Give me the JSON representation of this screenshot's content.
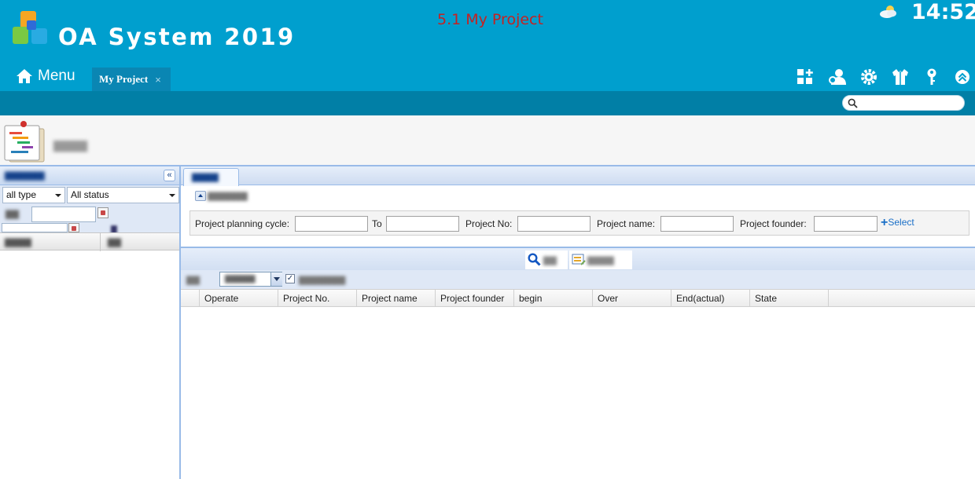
{
  "app": {
    "title": "OA System 2019",
    "page_heading": "5.1 My Project",
    "clock": "14:52",
    "weather_icon": "partly-cloudy-icon"
  },
  "nav": {
    "menu_label": "Menu",
    "tabs": [
      {
        "label": "My Project",
        "close": "×",
        "active": true
      }
    ],
    "header_icons": [
      "add-widget-icon",
      "user-settings-icon",
      "gear-icon",
      "shirt-icon",
      "key-icon",
      "collapse-up-icon"
    ],
    "search": {
      "placeholder": "",
      "value": ""
    }
  },
  "left_panel": {
    "type_select": "all type",
    "status_select": "All status"
  },
  "search_form": {
    "cycle_label": "Project planning cycle:",
    "to_label": "To",
    "project_no_label": "Project No:",
    "project_name_label": "Project name:",
    "founder_label": "Project founder:",
    "select_plus": "+",
    "select_label": "Select"
  },
  "grid": {
    "columns": [
      "Operate",
      "Project No.",
      "Project name",
      "Project founder",
      "begin",
      "Over",
      "End(actual)",
      "State"
    ],
    "rows": []
  },
  "colors": {
    "header_bg": "#009fce",
    "subbar_bg": "#017fa6",
    "heading_red": "#c62121",
    "panel_border": "#99bbe8",
    "link_blue": "#1a6fc7"
  }
}
